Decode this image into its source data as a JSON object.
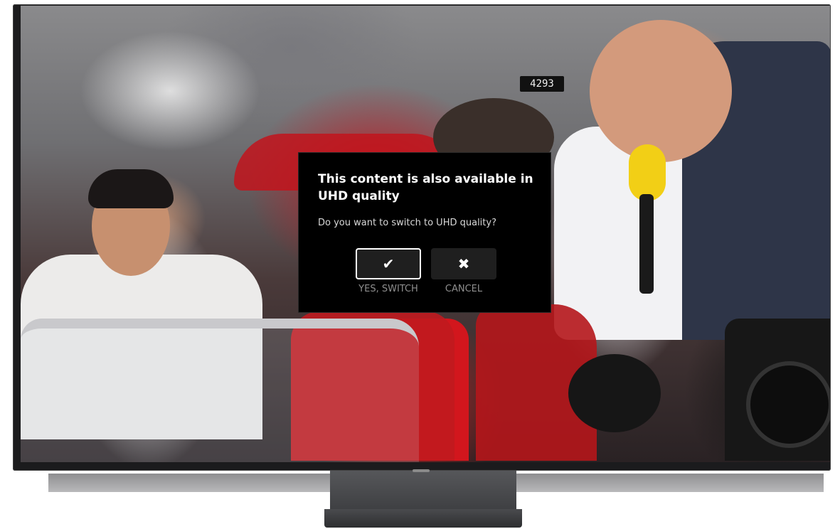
{
  "dialog": {
    "title": "This content is also available in UHD quality",
    "question": "Do you want to switch to UHD quality?",
    "buttons": {
      "yes": {
        "icon": "check-icon",
        "glyph": "✔",
        "label": "YES, SWITCH"
      },
      "cancel": {
        "icon": "close-icon",
        "glyph": "✖",
        "label": "CANCEL"
      }
    }
  },
  "background": {
    "car_plate": "4293"
  },
  "colors": {
    "dialog_bg": "#000000",
    "button_bg": "#1f1f1f",
    "focus_border": "#ffffff",
    "label_color": "#8f8f8f"
  }
}
